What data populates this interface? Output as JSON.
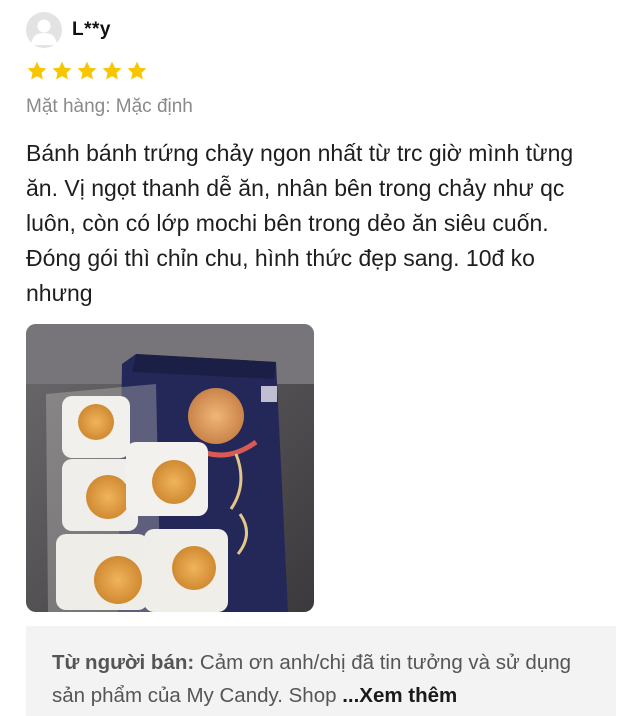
{
  "review": {
    "username": "L**y",
    "rating": 5,
    "rating_max": 5,
    "star_color": "#f7c600",
    "variant_label": "Mặt hàng: Mặc định",
    "text": "Bánh bánh trứng chảy ngon nhất từ trc giờ mình từng ăn. Vị ngọt thanh dễ ăn, nhân bên trong chảy như qc luôn, còn có lớp mochi bên trong dẻo ăn siêu cuốn. Đóng gói thì chỉn chu, hình thức đẹp sang. 10đ ko nhưng",
    "photo_icon": "mooncake-box-photo"
  },
  "seller_reply": {
    "label": "Từ người bán:",
    "text": " Cảm ơn anh/chị đã tin tưởng và sử dụng sản phẩm của My Candy. Shop ",
    "more_label": "...Xem thêm"
  }
}
